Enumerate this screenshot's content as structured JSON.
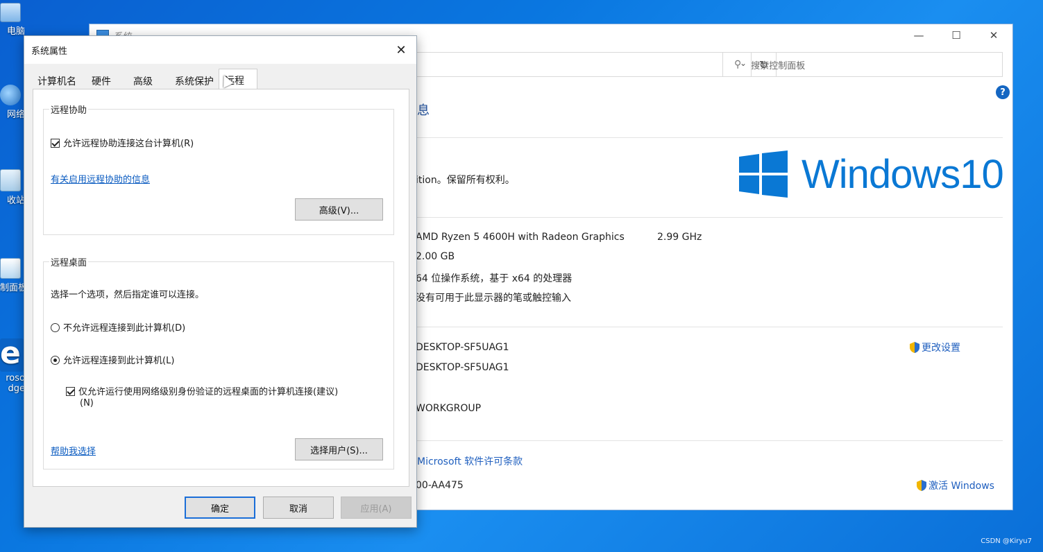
{
  "desktop": {
    "icons": [
      {
        "label": "电脑"
      },
      {
        "label": "网络"
      },
      {
        "label": "收站"
      },
      {
        "label": "制面板"
      },
      {
        "label": "roso"
      },
      {
        "label": "dge"
      }
    ],
    "watermark": "CSDN @Kiryu7"
  },
  "system_window": {
    "title": "系统",
    "search_placeholder": "搜索控制面板",
    "heading_fragment": "息",
    "copyright": "ition。保留所有权利。",
    "brand_text": "Windows10",
    "processor": "AMD Ryzen 5 4600H with Radeon Graphics",
    "processor_speed": "2.99 GHz",
    "ram": "2.00 GB",
    "system_type": "64 位操作系统，基于 x64 的处理器",
    "pen_touch": "没有可用于此显示器的笔或触控输入",
    "computer_name": "DESKTOP-SF5UAG1",
    "full_computer_name": "DESKTOP-SF5UAG1",
    "workgroup": "WORKGROUP",
    "change_settings": "更改设置",
    "license_terms": "Microsoft 软件许可条款",
    "product_id": "00-AA475",
    "activate": "激活 Windows"
  },
  "dialog": {
    "title": "系统属性",
    "tabs": [
      {
        "label": "计算机名"
      },
      {
        "label": "硬件"
      },
      {
        "label": "高级"
      },
      {
        "label": "系统保护"
      },
      {
        "label": "远程"
      }
    ],
    "remote_assistance": {
      "title": "远程协助",
      "allow_label": "允许远程协助连接这台计算机(R)",
      "allow_checked": true,
      "info_link": "有关启用远程协助的信息",
      "advanced_button": "高级(V)..."
    },
    "remote_desktop": {
      "title": "远程桌面",
      "instruction": "选择一个选项，然后指定谁可以连接。",
      "deny_label": "不允许远程连接到此计算机(D)",
      "allow_label": "允许远程连接到此计算机(L)",
      "selected": "allow",
      "nla_label_line1": "仅允许运行使用网络级别身份验证的远程桌面的计算机连接(建议)",
      "nla_label_line2": "(N)",
      "nla_checked": true,
      "help_link": "帮助我选择",
      "select_users_button": "选择用户(S)..."
    },
    "buttons": {
      "ok": "确定",
      "cancel": "取消",
      "apply": "应用(A)"
    }
  }
}
